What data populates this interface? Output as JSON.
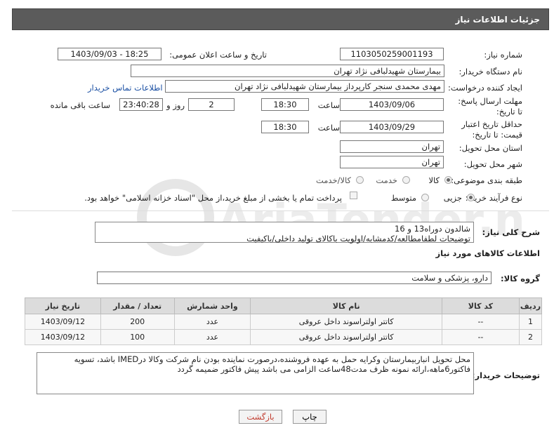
{
  "header": {
    "title": "جزئیات اطلاعات نیاز"
  },
  "fields": {
    "need_number_label": "شماره نیاز:",
    "need_number": "1103050259001193",
    "announce_label": "تاریخ و ساعت اعلان عمومی:",
    "announce_value": "1403/09/03 - 18:25",
    "buyer_org_label": "نام دستگاه خریدار:",
    "buyer_org": "بیمارستان شهیدلبافی نژاد تهران",
    "creator_label": "ایجاد کننده درخواست:",
    "creator": "مهدی محمدی سنجر کارپرداز بیمارستان شهیدلبافی نژاد تهران",
    "contact_link": "اطلاعات تماس خریدار",
    "send_deadline_label": "مهلت ارسال پاسخ: تا تاریخ:",
    "send_deadline_date": "1403/09/06",
    "time_label": "ساعت",
    "send_deadline_time": "18:30",
    "days_value": "2",
    "days_label": "روز و",
    "remaining_time": "23:40:28",
    "remaining_label": "ساعت باقی مانده",
    "price_validity_label": "حداقل تاریخ اعتبار قیمت: تا تاریخ:",
    "price_validity_date": "1403/09/29",
    "price_validity_time": "18:30",
    "province_label": "استان محل تحویل:",
    "province": "تهران",
    "city_label": "شهر محل تحویل:",
    "city": "تهران",
    "category_label": "طبقه بندی موضوعی:",
    "category_options": [
      "کالا",
      "خدمت",
      "کالا/خدمت"
    ],
    "process_label": "نوع فرآیند خرید :",
    "process_options": [
      "جزیی",
      "متوسط"
    ],
    "payment_note": "پرداخت تمام یا بخشی از مبلغ خرید،از محل \"اسناد خزانه اسلامی\" خواهد بود.",
    "summary_label": "شرح کلی نیاز:",
    "summary_line1": "شالدون دوراه13 و 16",
    "summary_line2": "توضیحات لطفامطالعه/کدمشابه/اولویت باکالای تولید داخلی/باکیفیت",
    "goods_info_title": "اطلاعات کالاهای مورد نیاز",
    "goods_group_label": "گروه کالا:",
    "goods_group": "دارو، پزشکی و سلامت",
    "buyer_notes_label": "توضیحات خریدار:",
    "buyer_notes": "محل تحویل انباربیمارستان وکرایه حمل به عهده فروشنده،درصورت نماینده بودن نام شرکت وکالا درIMED باشد، تسویه فاکتور6ماهه،ارائه نمونه ظرف مدت48ساعت الزامی می باشد پیش فاکتور ضمیمه گردد"
  },
  "table": {
    "headers": [
      "ردیف",
      "کد کالا",
      "نام کالا",
      "واحد شمارش",
      "تعداد / مقدار",
      "تاریخ نیاز"
    ],
    "rows": [
      [
        "1",
        "--",
        "کاتتر اولتراسوند داخل عروقی",
        "عدد",
        "200",
        "1403/09/12"
      ],
      [
        "2",
        "--",
        "کاتتر اولتراسوند داخل عروقی",
        "عدد",
        "100",
        "1403/09/12"
      ]
    ]
  },
  "buttons": {
    "print": "چاپ",
    "back": "بازگشت"
  },
  "watermark": {
    "text": "AriaTender.net"
  },
  "colors": {
    "header_bg": "#5b5b5b",
    "link": "#1a4fa3",
    "back_text": "#c0392b"
  }
}
